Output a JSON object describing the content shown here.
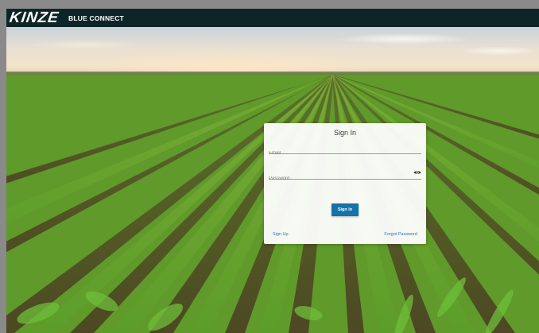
{
  "header": {
    "logo_text": "KINZE",
    "app_name": "BLUE CONNECT"
  },
  "signin": {
    "title": "Sign In",
    "email_placeholder": "Email",
    "password_placeholder": "Password",
    "password_toggle_icon": "eye-icon",
    "submit_label": "Sign In",
    "signup_link": "Sign Up",
    "forgot_link": "Forgot Password"
  },
  "colors": {
    "header_bg": "#0e2527",
    "primary_button": "#1473a8",
    "link": "#2f73b7"
  }
}
